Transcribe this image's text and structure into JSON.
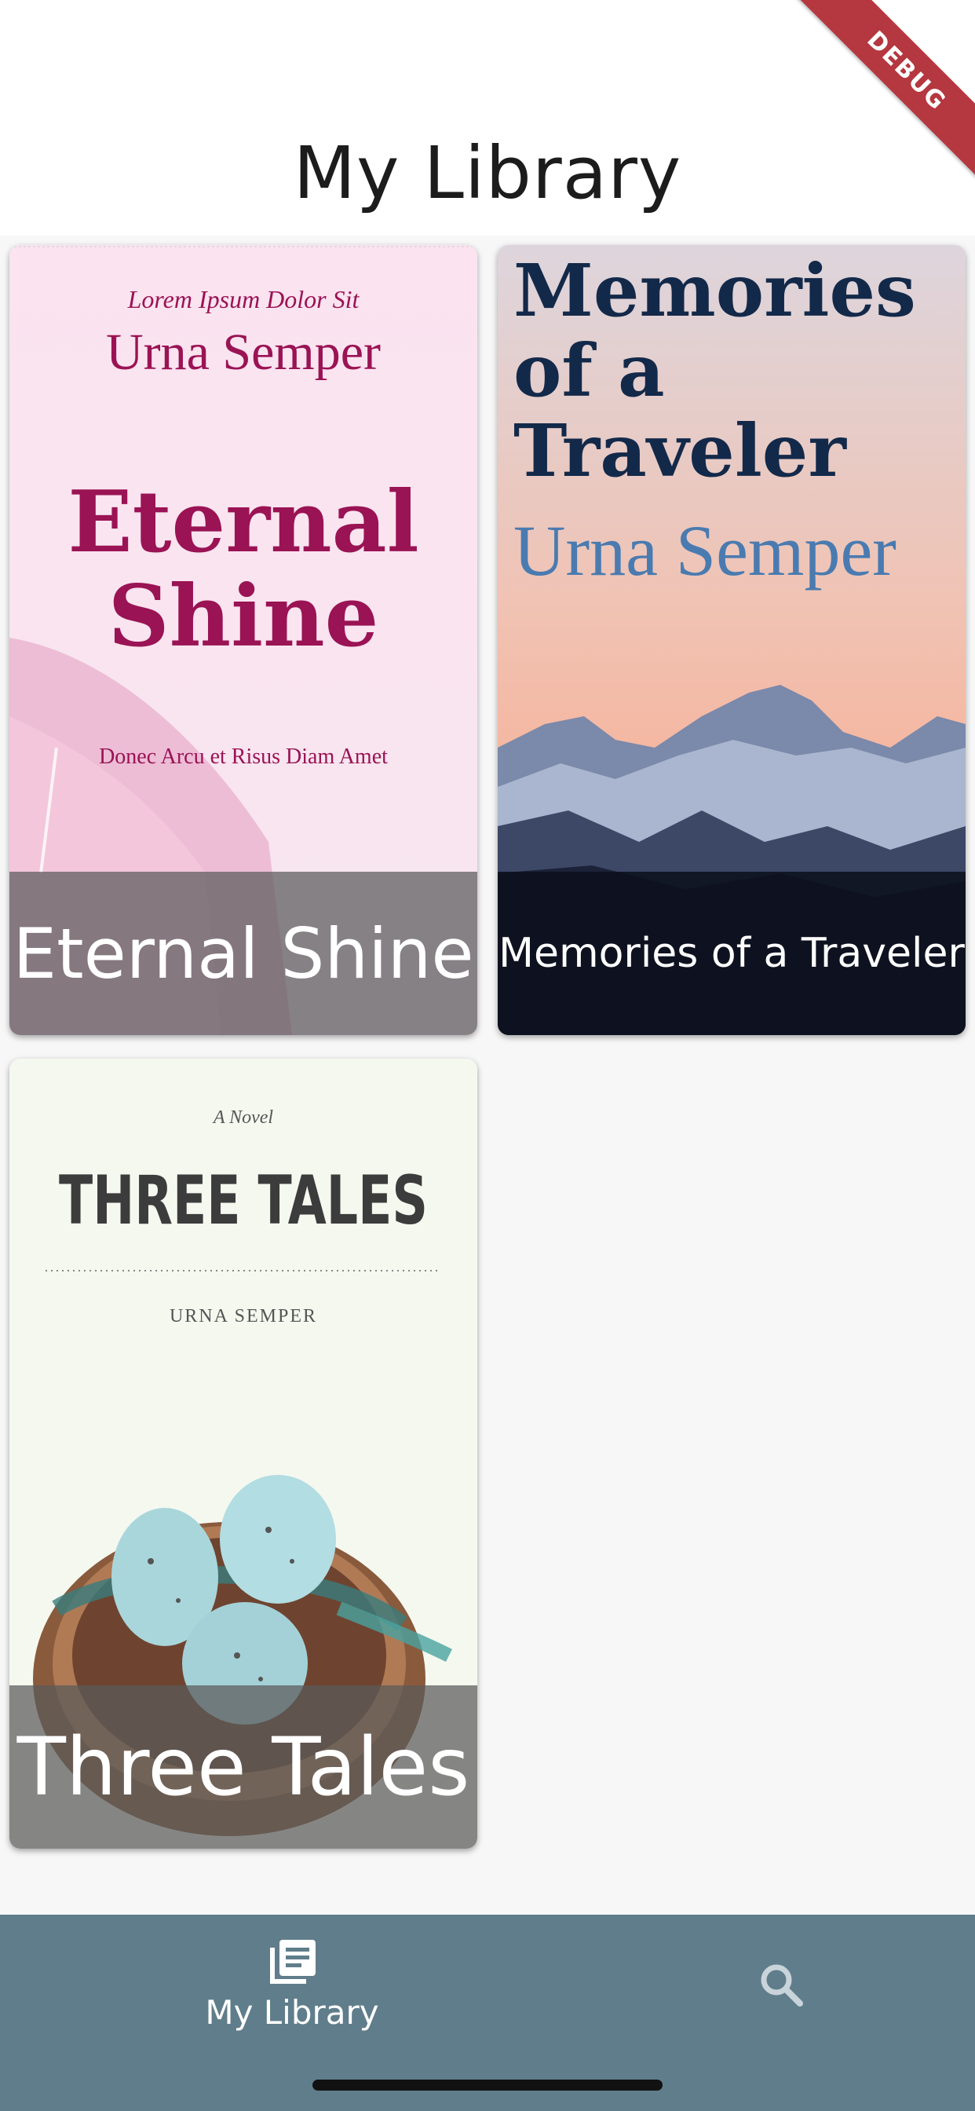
{
  "app_bar": {
    "title": "My Library"
  },
  "debug_banner": {
    "label": "DEBUG",
    "color": "#b5373f"
  },
  "books": [
    {
      "title": "Eternal Shine",
      "cover": {
        "tagline": "Lorem Ipsum Dolor Sit",
        "author": "Urna Semper",
        "title_line1": "Eternal",
        "title_line2": "Shine",
        "subtitle": "Donec Arcu et Risus Diam Amet"
      }
    },
    {
      "title": "Memories of a Traveler",
      "cover": {
        "title_line1": "Memories",
        "title_line2": "of a",
        "title_line3": "Traveler",
        "author": "Urna Semper"
      }
    },
    {
      "title": "Three Tales",
      "cover": {
        "kicker": "A Novel",
        "title": "THREE TALES",
        "author": "URNA SEMPER"
      }
    }
  ],
  "bottom_nav": {
    "items": [
      {
        "label": "My Library",
        "icon": "library-books-icon"
      },
      {
        "label": "",
        "icon": "search-icon"
      }
    ],
    "background": "#607d8b"
  }
}
